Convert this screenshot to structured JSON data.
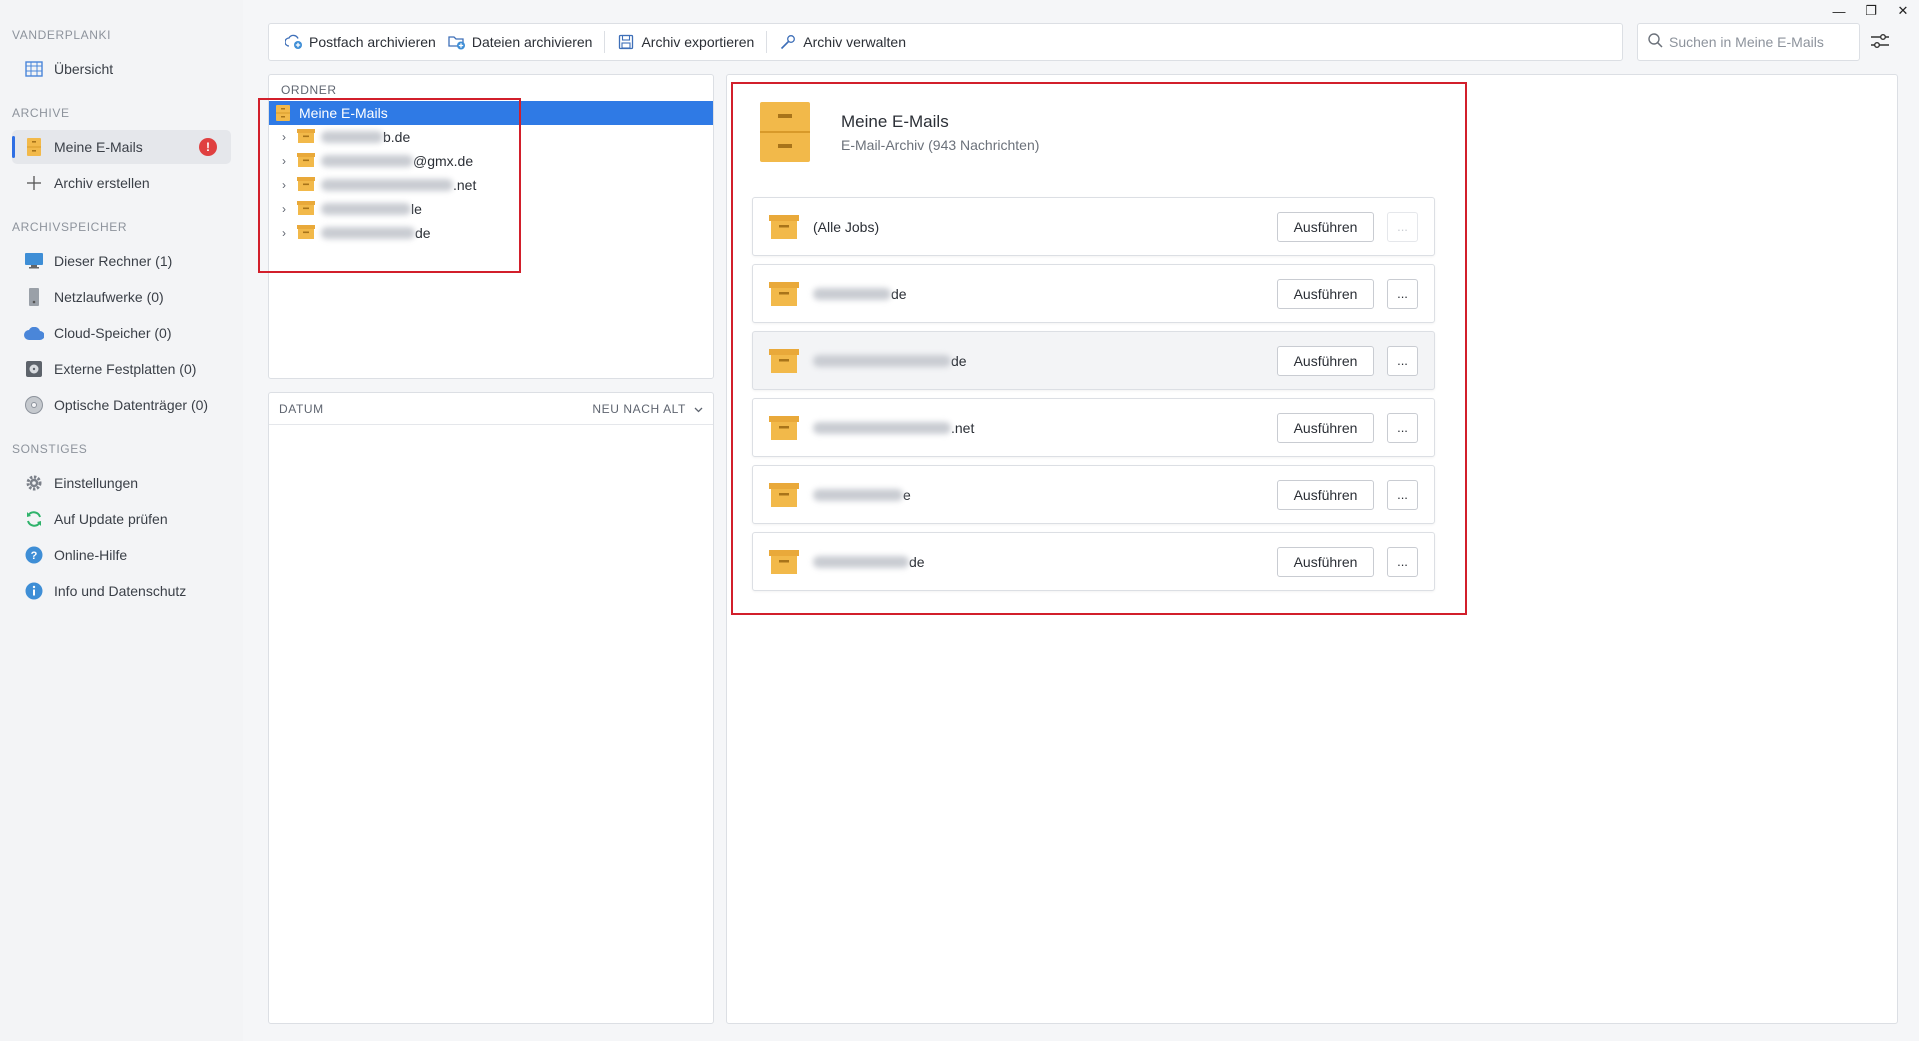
{
  "window": {
    "minimize": "—",
    "restore": "❐",
    "close": "✕"
  },
  "sidebar": {
    "sections": [
      {
        "title": "VANDERPLANKI",
        "items": [
          {
            "label": "Übersicht",
            "icon": "grid-icon"
          }
        ]
      },
      {
        "title": "ARCHIVE",
        "items": [
          {
            "label": "Meine E-Mails",
            "icon": "cabinet-icon",
            "active": true,
            "badge": "!"
          },
          {
            "label": "Archiv erstellen",
            "icon": "plus-icon"
          }
        ]
      },
      {
        "title": "ARCHIVSPEICHER",
        "items": [
          {
            "label": "Dieser Rechner (1)",
            "icon": "monitor-icon"
          },
          {
            "label": "Netzlaufwerke (0)",
            "icon": "server-icon"
          },
          {
            "label": "Cloud-Speicher (0)",
            "icon": "cloud-icon"
          },
          {
            "label": "Externe Festplatten (0)",
            "icon": "harddrive-icon"
          },
          {
            "label": "Optische Datenträger (0)",
            "icon": "disc-icon"
          }
        ]
      },
      {
        "title": "SONSTIGES",
        "items": [
          {
            "label": "Einstellungen",
            "icon": "gear-icon"
          },
          {
            "label": "Auf Update prüfen",
            "icon": "refresh-icon"
          },
          {
            "label": "Online-Hilfe",
            "icon": "help-icon"
          },
          {
            "label": "Info und Datenschutz",
            "icon": "info-icon"
          }
        ]
      }
    ]
  },
  "toolbar": {
    "archive_mailbox": "Postfach archivieren",
    "archive_files": "Dateien archivieren",
    "export_archive": "Archiv exportieren",
    "manage_archive": "Archiv verwalten"
  },
  "search": {
    "placeholder": "Suchen in Meine E-Mails"
  },
  "folders": {
    "header": "ORDNER",
    "root": "Meine E-Mails",
    "children": [
      {
        "suffix": "b.de"
      },
      {
        "suffix": "@gmx.de"
      },
      {
        "suffix": ".net"
      },
      {
        "suffix": "le"
      },
      {
        "suffix": "de"
      }
    ]
  },
  "date_panel": {
    "header": "DATUM",
    "sort_label": "NEU NACH ALT"
  },
  "archive": {
    "title": "Meine E-Mails",
    "subtitle": "E-Mail-Archiv (943 Nachrichten)",
    "run_label": "Ausführen",
    "more_label": "...",
    "jobs": [
      {
        "label": "(Alle Jobs)"
      },
      {
        "suffix": "de"
      },
      {
        "suffix": "de"
      },
      {
        "suffix": ".net"
      },
      {
        "suffix": "e"
      },
      {
        "suffix": "de"
      }
    ]
  },
  "colors": {
    "accent": "#2f7ae5",
    "highlight": "#d21f2b",
    "folder": "#f2b94a"
  }
}
